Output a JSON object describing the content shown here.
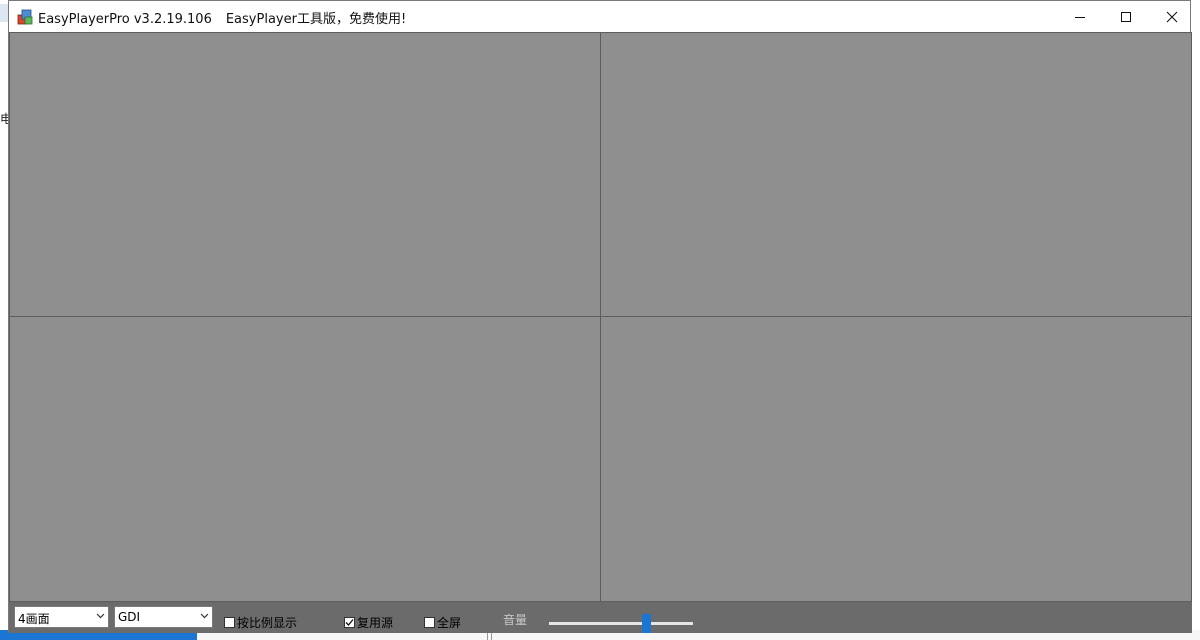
{
  "window": {
    "title_app": "EasyPlayerPro v3.2.19.106",
    "title_note": "EasyPlayer工具版，免费使用!"
  },
  "background": {
    "left_fragment_text": "电"
  },
  "controls": {
    "layout_select": {
      "value": "4画面"
    },
    "render_select": {
      "value": "GDI"
    },
    "keep_ratio": {
      "label": "按比例显示",
      "checked": false
    },
    "reuse_source": {
      "label": "复用源",
      "checked": true
    },
    "fullscreen": {
      "label": "全屏",
      "checked": false
    },
    "volume": {
      "label": "音量",
      "level": 0.69
    }
  },
  "colors": {
    "video_bg": "#8f8f8f",
    "control_bar": "#6b6b6b",
    "slider_thumb": "#1a76d2"
  }
}
